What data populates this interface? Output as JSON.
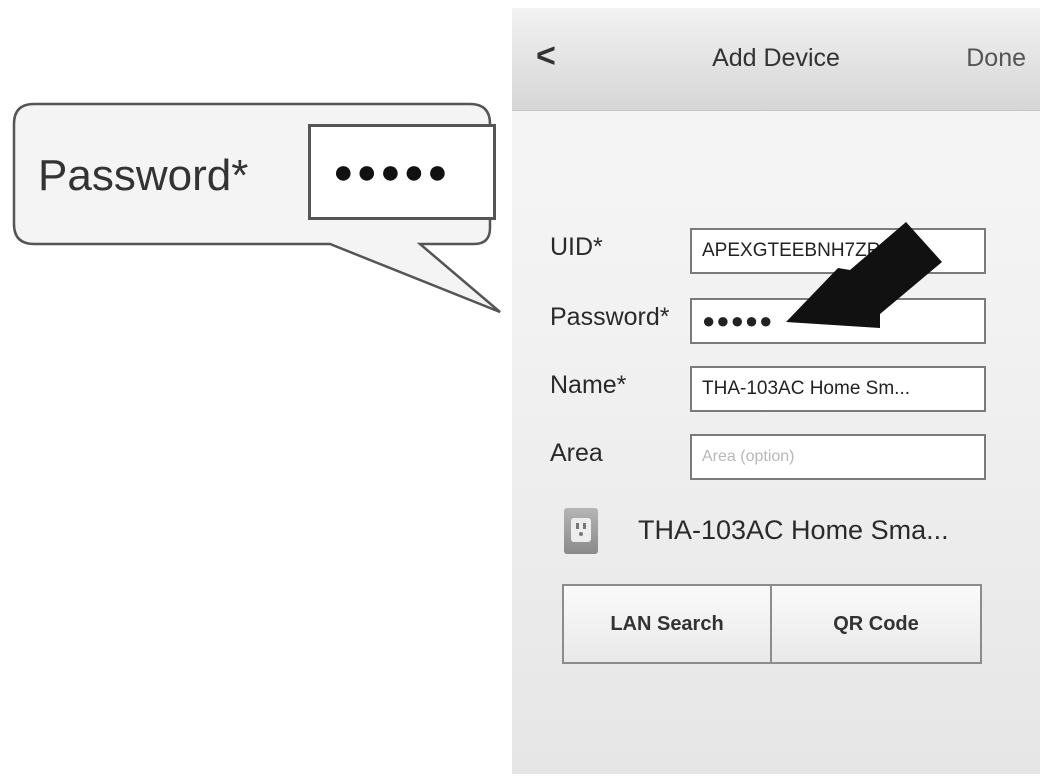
{
  "navbar": {
    "back_label": "<",
    "title": "Add Device",
    "done_label": "Done"
  },
  "form": {
    "uid": {
      "label": "UID*",
      "value": "APEXGTEEBNH7ZRHY..."
    },
    "password": {
      "label": "Password*",
      "value": "●●●●●"
    },
    "name": {
      "label": "Name*",
      "value": "THA-103AC Home Sm..."
    },
    "area": {
      "label": "Area",
      "placeholder": "Area (option)"
    }
  },
  "device": {
    "icon": "wall-outlet-icon",
    "name": "THA-103AC Home Sma..."
  },
  "buttons": {
    "lan_search": "LAN Search",
    "qr_code": "QR Code"
  },
  "callout": {
    "label": "Password*",
    "value": "●●●●●"
  },
  "colors": {
    "arrow": "#111111",
    "navbar": "#dcdcdc",
    "field_border": "#7a7a7a"
  }
}
